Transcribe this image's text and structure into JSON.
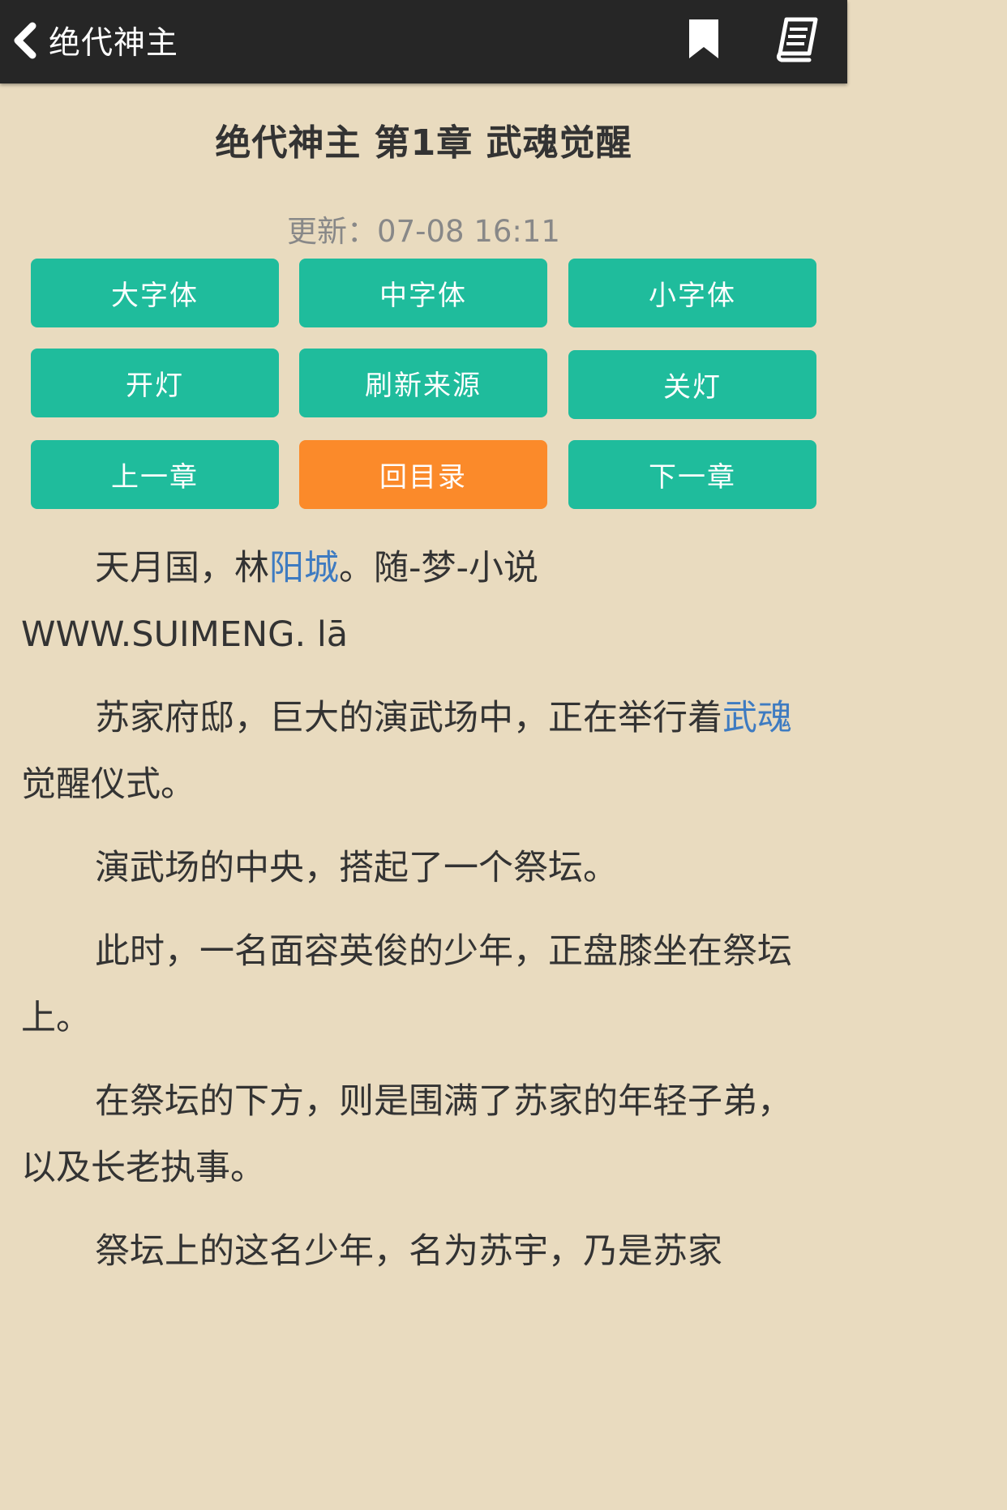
{
  "header": {
    "title": "绝代神主",
    "back_icon": "chevron-left-icon",
    "bookmark_icon": "bookmark-icon",
    "book_icon": "book-icon"
  },
  "chapter": {
    "title": "绝代神主 第1章 武魂觉醒",
    "update": "更新：07-08 16:11"
  },
  "controls": {
    "large_font": "大字体",
    "medium_font": "中字体",
    "small_font": "小字体",
    "light_on": "开灯",
    "refresh_source": "刷新来源",
    "light_off": "关灯",
    "prev_chapter": "上一章",
    "toc": "回目录",
    "next_chapter": "下一章"
  },
  "colors": {
    "teal": "#1fbc9c",
    "orange": "#fb8a2a",
    "link": "#3e7bc1",
    "background": "#e9dbbf",
    "topbar": "#262626"
  },
  "content": {
    "p1_a": "天月国，林",
    "p1_link": "阳城",
    "p1_b": "。随-梦-小说 WWW.SUIMENG. lā",
    "p2_a": "苏家府邸，巨大的演武场中，正在举行着",
    "p2_link": "武魂",
    "p2_b": "觉醒仪式。",
    "p3": "演武场的中央，搭起了一个祭坛。",
    "p4": "此时，一名面容英俊的少年，正盘膝坐在祭坛上。",
    "p5": "在祭坛的下方，则是围满了苏家的年轻子弟，以及长老执事。",
    "p6": "祭坛上的这名少年，名为苏宇，乃是苏家"
  }
}
